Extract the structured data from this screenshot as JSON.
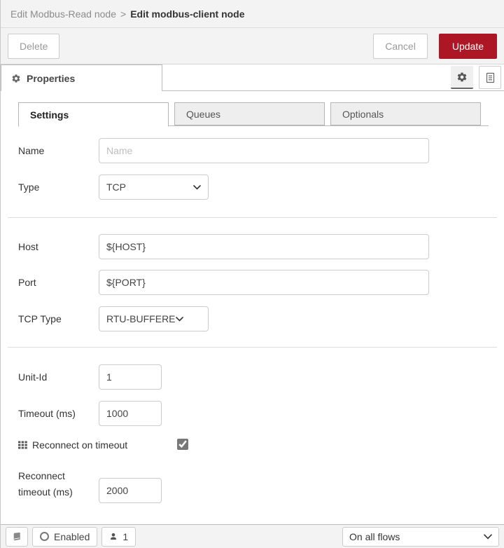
{
  "colors": {
    "accent_red": "#AD1625",
    "panel_gray": "#f3f3f3",
    "border_gray": "#bbbbbb"
  },
  "icons": {
    "properties_gear": "gear",
    "toolbar_gear": "gear",
    "description_doc": "document-with-lines",
    "reconnect_grid": "grid-3x3",
    "footer_book": "book",
    "enabled_circle": "circle-outline",
    "user": "person",
    "select_chevron": "chevron-down"
  },
  "breadcrumb": {
    "parent": "Edit Modbus-Read node",
    "separator": ">",
    "current": "Edit modbus-client node"
  },
  "toolbar": {
    "delete_label": "Delete",
    "cancel_label": "Cancel",
    "update_label": "Update"
  },
  "tray": {
    "properties_tab_label": "Properties"
  },
  "subtabs": {
    "settings": "Settings",
    "queues": "Queues",
    "optionals": "Optionals"
  },
  "form": {
    "name": {
      "label": "Name",
      "placeholder": "Name",
      "value": ""
    },
    "type": {
      "label": "Type",
      "value": "TCP"
    },
    "host": {
      "label": "Host",
      "value": "${HOST}"
    },
    "port": {
      "label": "Port",
      "value": "${PORT}"
    },
    "tcp_type": {
      "label": "TCP Type",
      "value": "RTU-BUFFERED"
    },
    "unit_id": {
      "label": "Unit-Id",
      "value": "1"
    },
    "timeout": {
      "label": "Timeout (ms)",
      "value": "1000"
    },
    "reconnect_on_timeout": {
      "label": "Reconnect on timeout",
      "checked": true
    },
    "reconnect_timeout": {
      "label_line1": "Reconnect",
      "label_line2": "timeout (ms)",
      "value": "2000"
    }
  },
  "footer": {
    "enabled_label": "Enabled",
    "user_count": "1",
    "deploy_scope": "On all flows"
  }
}
